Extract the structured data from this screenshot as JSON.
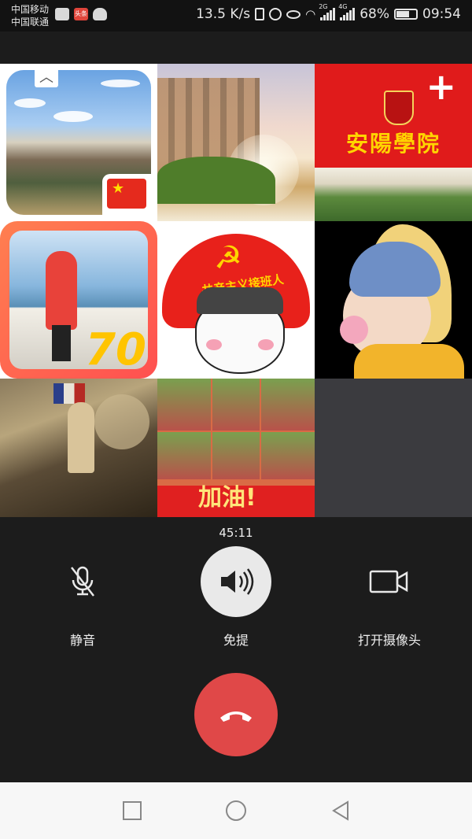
{
  "status_bar": {
    "carrier_1": "中国移动",
    "carrier_2": "中国联通",
    "net_speed": "13.5 K/s",
    "signal_1_label": "2G",
    "signal_2_label": "4G",
    "battery_percent": "68%",
    "battery_level": 0.68,
    "time": "09:54",
    "app_badge": "头条"
  },
  "grid": {
    "college_name": "安陽學院",
    "meme_helmet_text": "共产主义接班人",
    "seventy_text": "70",
    "jiayou_text": "加油!"
  },
  "call": {
    "duration": "45:11",
    "mute_label": "静音",
    "speaker_label": "免提",
    "camera_label": "打开摄像头"
  },
  "colors": {
    "background": "#1c1c1c",
    "hangup": "#e04848",
    "speaker_active": "#e9e9e9",
    "empty_tile": "#3b3b3f"
  }
}
